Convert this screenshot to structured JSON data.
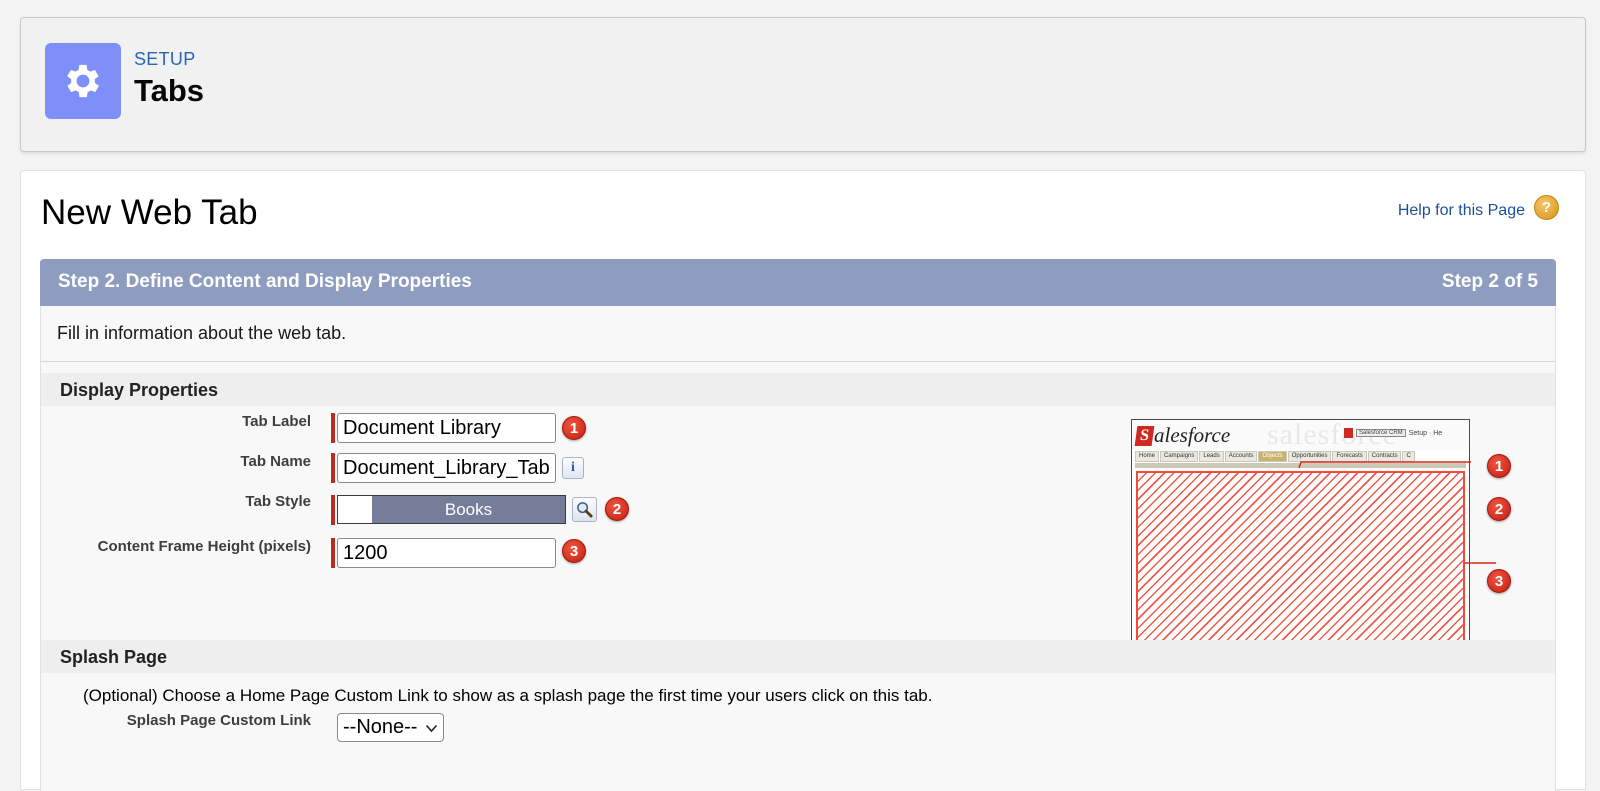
{
  "header": {
    "eyebrow": "SETUP",
    "title": "Tabs",
    "icon": "gear-icon"
  },
  "page": {
    "title": "New Web Tab",
    "help_link": "Help for this Page",
    "help_icon": "?"
  },
  "step": {
    "title": "Step 2. Define Content and Display Properties",
    "count": "Step 2 of 5"
  },
  "intro": "Fill in information about the web tab.",
  "display_properties": {
    "heading": "Display Properties",
    "tab_label": {
      "label": "Tab Label",
      "value": "Document Library",
      "badge": "1"
    },
    "tab_name": {
      "label": "Tab Name",
      "value": "Document_Library_Tab",
      "info": "i"
    },
    "tab_style": {
      "label": "Tab Style",
      "value": "Books",
      "badge": "2"
    },
    "frame_height": {
      "label": "Content Frame Height (pixels)",
      "value": "1200",
      "badge": "3"
    }
  },
  "preview": {
    "logo_letter": "S",
    "logo_text": "alesforce",
    "watermark": "salesforce",
    "app_select": "Salesforce CRM",
    "app_links": "Setup · He",
    "tabs": [
      "Home",
      "Campaigns",
      "Leads",
      "Accounts",
      "Objects",
      "Opportunities",
      "Forecasts",
      "Contracts",
      "C"
    ],
    "active_tab": "Objects",
    "callouts": [
      "1",
      "2",
      "3"
    ]
  },
  "splash": {
    "heading": "Splash Page",
    "note": "(Optional) Choose a Home Page Custom Link to show as a splash page the first time your users click on this tab.",
    "custom_link_label": "Splash Page Custom Link",
    "custom_link_value": "--None--"
  },
  "colors": {
    "step_bar": "#8e9dbf",
    "header_icon_bg": "#7f8ff9",
    "required": "#b72d22",
    "tab_style_bg": "#767d99",
    "badge": "#d2261a"
  }
}
